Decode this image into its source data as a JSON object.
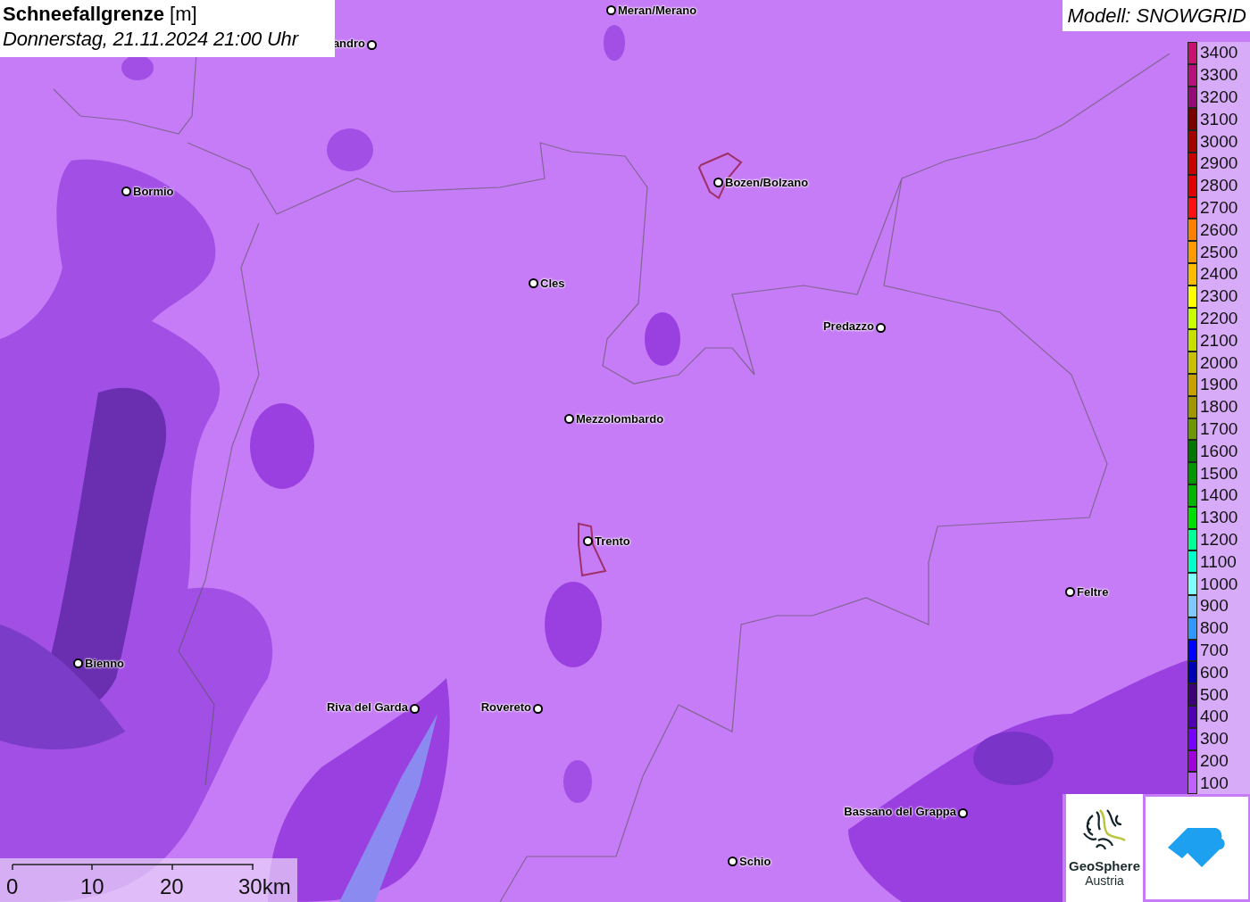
{
  "header": {
    "title": "Schneefallgrenze",
    "unit": "[m]",
    "datetime": "Donnerstag, 21.11.2024 21:00 Uhr"
  },
  "model": "Modell: SNOWGRID",
  "places": [
    {
      "name": "andro"
    },
    {
      "name": "Meran/Merano"
    },
    {
      "name": "Bormio"
    },
    {
      "name": "Bozen/Bolzano"
    },
    {
      "name": "Cles"
    },
    {
      "name": "Predazzo"
    },
    {
      "name": "Mezzolombardo"
    },
    {
      "name": "Trento"
    },
    {
      "name": "Feltre"
    },
    {
      "name": "Bienno"
    },
    {
      "name": "Riva del Garda"
    },
    {
      "name": "Rovereto"
    },
    {
      "name": "Bassano del Grappa"
    },
    {
      "name": "Schio"
    }
  ],
  "legend": [
    {
      "label": "3400",
      "color": "#c8106e"
    },
    {
      "label": "3300",
      "color": "#b8107a"
    },
    {
      "label": "3200",
      "color": "#960a78"
    },
    {
      "label": "3100",
      "color": "#7a0000"
    },
    {
      "label": "3000",
      "color": "#a50000"
    },
    {
      "label": "2900",
      "color": "#c80000"
    },
    {
      "label": "2800",
      "color": "#e00000"
    },
    {
      "label": "2700",
      "color": "#ff1010"
    },
    {
      "label": "2600",
      "color": "#ff7f00"
    },
    {
      "label": "2500",
      "color": "#ff9a00"
    },
    {
      "label": "2400",
      "color": "#ffbb00"
    },
    {
      "label": "2300",
      "color": "#ffff00"
    },
    {
      "label": "2200",
      "color": "#c8ff00"
    },
    {
      "label": "2100",
      "color": "#c8e000"
    },
    {
      "label": "2000",
      "color": "#c8c000"
    },
    {
      "label": "1900",
      "color": "#c8a000"
    },
    {
      "label": "1800",
      "color": "#a09600"
    },
    {
      "label": "1700",
      "color": "#6e9600"
    },
    {
      "label": "1600",
      "color": "#007800"
    },
    {
      "label": "1500",
      "color": "#009600"
    },
    {
      "label": "1400",
      "color": "#00b400"
    },
    {
      "label": "1300",
      "color": "#00e000"
    },
    {
      "label": "1200",
      "color": "#00ff96"
    },
    {
      "label": "1100",
      "color": "#00ffc8"
    },
    {
      "label": "1000",
      "color": "#80ffff"
    },
    {
      "label": "900",
      "color": "#80c8ff"
    },
    {
      "label": "800",
      "color": "#3296ff"
    },
    {
      "label": "700",
      "color": "#0000ff"
    },
    {
      "label": "600",
      "color": "#0000b4"
    },
    {
      "label": "500",
      "color": "#3c0078"
    },
    {
      "label": "400",
      "color": "#5000b4"
    },
    {
      "label": "300",
      "color": "#7800ff"
    },
    {
      "label": "200",
      "color": "#a000dc"
    },
    {
      "label": "100",
      "color": "#c060ff"
    }
  ],
  "scale": [
    "0",
    "10",
    "20",
    "30km"
  ],
  "logo": {
    "name": "GeoSphere",
    "country": "Austria"
  }
}
